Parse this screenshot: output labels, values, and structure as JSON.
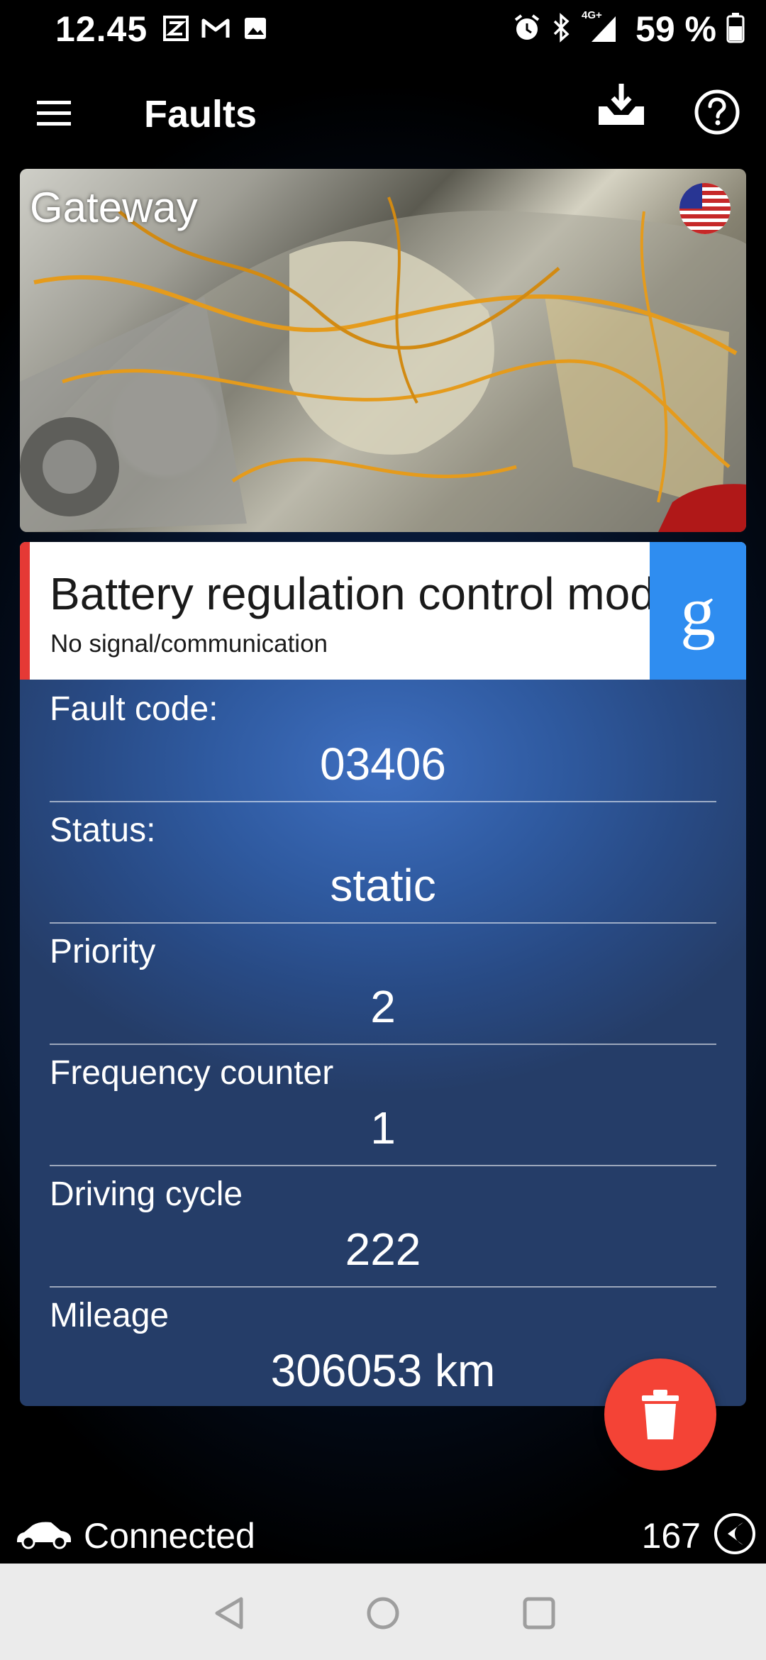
{
  "status_bar": {
    "time": "12.45",
    "left_icons": [
      "zedge-icon",
      "gmail-icon",
      "image-icon"
    ],
    "network": "4G+",
    "battery": "59 %"
  },
  "app_bar": {
    "title": "Faults"
  },
  "module": {
    "title": "Gateway",
    "flag": "us-flag-icon"
  },
  "fault": {
    "name": "Battery regulation control module",
    "description": "No signal/communication",
    "accent_color": "#e53935",
    "google_label": "g"
  },
  "details": [
    {
      "label": "Fault code:",
      "value": "03406"
    },
    {
      "label": "Status:",
      "value": "static"
    },
    {
      "label": "Priority",
      "value": "2"
    },
    {
      "label": "Frequency counter",
      "value": "1"
    },
    {
      "label": "Driving cycle",
      "value": "222"
    },
    {
      "label": "Mileage",
      "value": "306053 km"
    }
  ],
  "footer": {
    "status": "Connected",
    "count": "167"
  },
  "colors": {
    "fab": "#f44336",
    "google": "#2f8df0"
  }
}
